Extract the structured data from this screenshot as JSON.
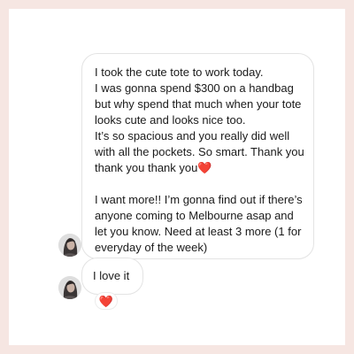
{
  "conversation": {
    "messages": [
      {
        "paragraphs": [
          "I took the cute tote to work today.",
          "I was gonna spend $300 on a handbag but why spend that much when your tote looks cute and looks nice too.",
          "It’s so spacious and you really did well with all the pockets. So smart. Thank you thank you thank you",
          "I want more!! I’m gonna find out if there’s anyone coming to Melbourne asap and let you know. Need at least 3 more (1 for everyday of the week)"
        ],
        "emoji": "❤️"
      },
      {
        "text": "I love it",
        "reaction": "❤️"
      }
    ]
  },
  "colors": {
    "background": "#f6e6e2",
    "bubble_border": "#e3e3e3",
    "heart": "#e0282e"
  },
  "icons": {
    "avatar": "user-avatar-photo",
    "heart": "heart-emoji"
  }
}
